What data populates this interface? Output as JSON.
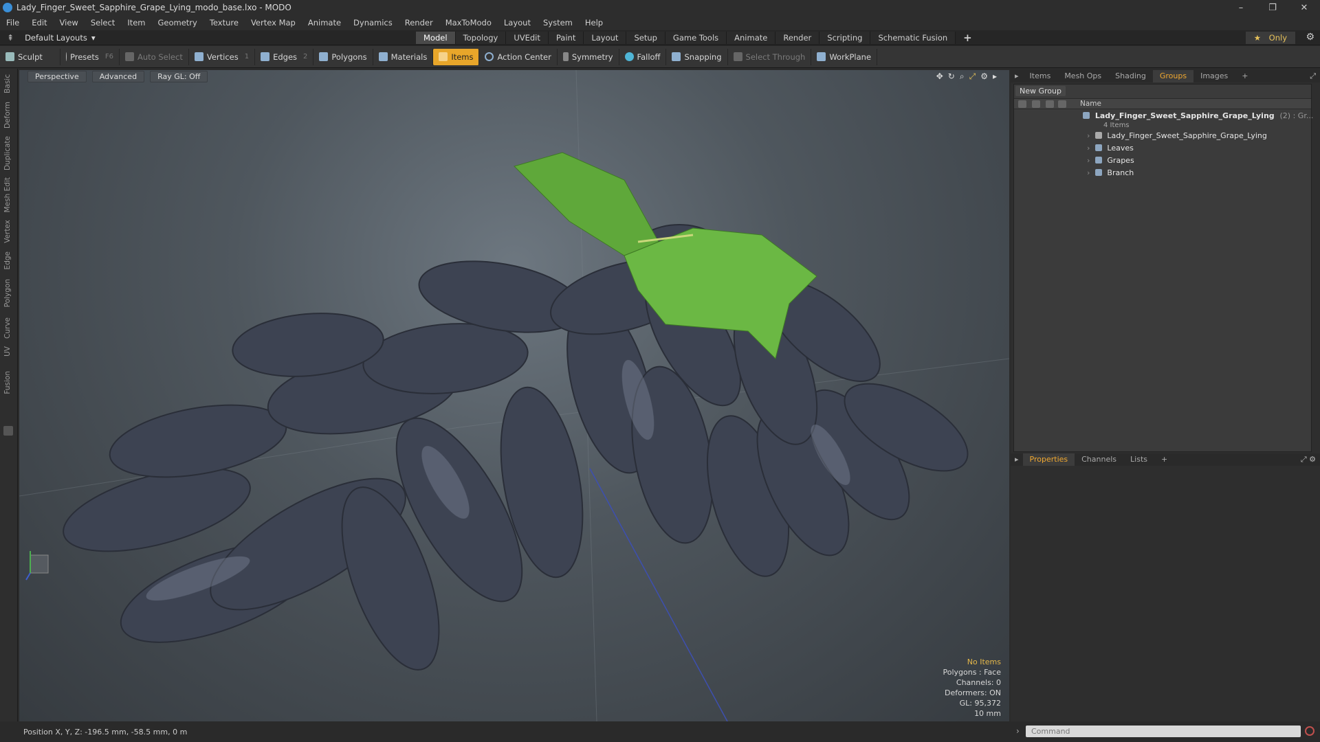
{
  "window": {
    "title": "Lady_Finger_Sweet_Sapphire_Grape_Lying_modo_base.lxo - MODO",
    "controls": [
      "–",
      "❐",
      "✕"
    ]
  },
  "menu": [
    "File",
    "Edit",
    "View",
    "Select",
    "Item",
    "Geometry",
    "Texture",
    "Vertex Map",
    "Animate",
    "Dynamics",
    "Render",
    "MaxToModo",
    "Layout",
    "System",
    "Help"
  ],
  "layoutbar": {
    "layout_name": "Default Layouts",
    "tabs": [
      "Model",
      "Topology",
      "UVEdit",
      "Paint",
      "Layout",
      "Setup",
      "Game Tools",
      "Animate",
      "Render",
      "Scripting",
      "Schematic Fusion"
    ],
    "active_tab": "Model",
    "add_tab": "+",
    "only_label": "Only"
  },
  "toolbar": {
    "sculpt": "Sculpt",
    "presets": "Presets",
    "presets_key": "F6",
    "auto_select": "Auto Select",
    "vertices": "Vertices",
    "vertices_key": "1",
    "edges": "Edges",
    "edges_key": "2",
    "polygons": "Polygons",
    "materials": "Materials",
    "items": "Items",
    "action_center": "Action Center",
    "symmetry": "Symmetry",
    "falloff": "Falloff",
    "snapping": "Snapping",
    "select_through": "Select Through",
    "workplane": "WorkPlane"
  },
  "left_tabs": [
    "Basic",
    "Deform",
    "Duplicate",
    "Mesh Edit",
    "Vertex",
    "Edge",
    "Polygon",
    "Curve",
    "UV",
    "Fusion"
  ],
  "viewport": {
    "view_mode": "Perspective",
    "shading": "Advanced",
    "raygl": "Ray GL: Off",
    "info": {
      "selection": "No Items",
      "polygons": "Polygons : Face",
      "channels": "Channels: 0",
      "deformers": "Deformers: ON",
      "gl": "GL: 95,372",
      "scale": "10 mm"
    }
  },
  "groups_panel": {
    "tabs": [
      "Items",
      "Mesh Ops",
      "Shading",
      "Groups",
      "Images"
    ],
    "active_tab": "Groups",
    "add_tab": "+",
    "new_group": "New Group",
    "column_name": "Name",
    "group_name": "Lady_Finger_Sweet_Sapphire_Grape_Lying",
    "group_suffix": "(2) : Gr...",
    "group_count": "4 Items",
    "children": [
      "Lady_Finger_Sweet_Sapphire_Grape_Lying",
      "Leaves",
      "Grapes",
      "Branch"
    ]
  },
  "properties_panel": {
    "tabs": [
      "Properties",
      "Channels",
      "Lists"
    ],
    "active_tab": "Properties",
    "add_tab": "+"
  },
  "status": {
    "position": "Position X, Y, Z:  -196.5 mm, -58.5 mm, 0 m",
    "command_placeholder": "Command"
  },
  "colors": {
    "accent": "#f0a830",
    "grape": "#3c4250",
    "leaf": "#5fa83a"
  }
}
